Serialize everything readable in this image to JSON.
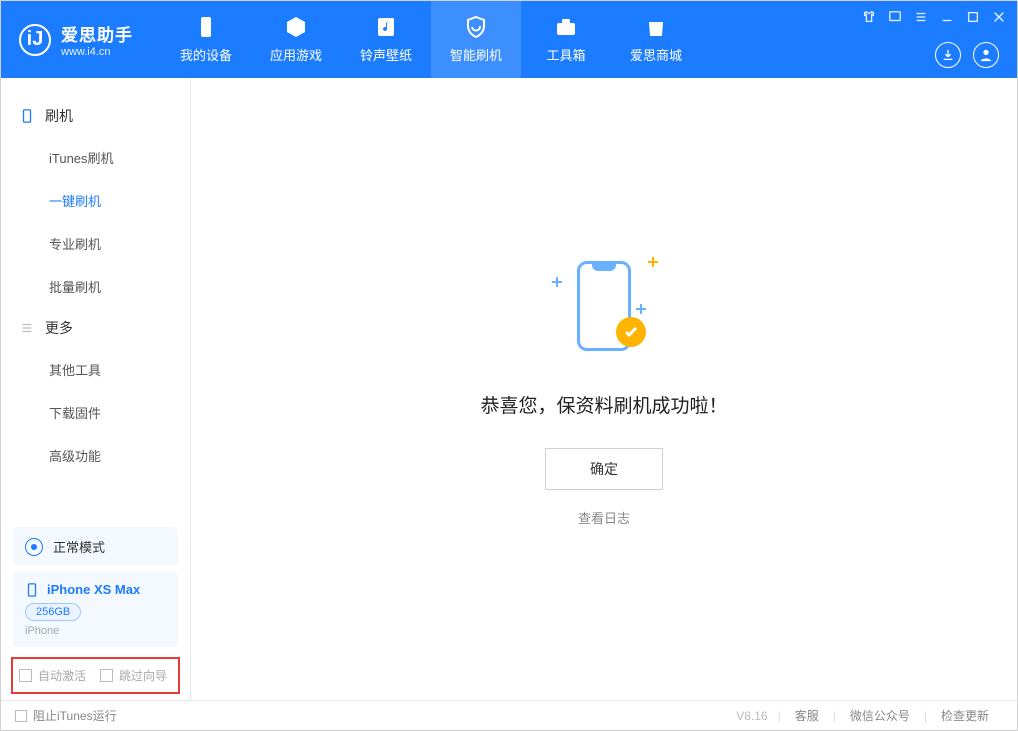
{
  "header": {
    "app_name": "爱思助手",
    "app_site": "www.i4.cn",
    "tabs": [
      {
        "label": "我的设备"
      },
      {
        "label": "应用游戏"
      },
      {
        "label": "铃声壁纸"
      },
      {
        "label": "智能刷机"
      },
      {
        "label": "工具箱"
      },
      {
        "label": "爱思商城"
      }
    ]
  },
  "sidebar": {
    "group1_title": "刷机",
    "group1_items": [
      "iTunes刷机",
      "一键刷机",
      "专业刷机",
      "批量刷机"
    ],
    "group2_title": "更多",
    "group2_items": [
      "其他工具",
      "下载固件",
      "高级功能"
    ],
    "status_label": "正常模式",
    "device_name": "iPhone XS Max",
    "device_storage": "256GB",
    "device_type": "iPhone",
    "checkbox_activate": "自动激活",
    "checkbox_skip": "跳过向导"
  },
  "main": {
    "success_message": "恭喜您，保资料刷机成功啦！",
    "ok_button": "确定",
    "view_log": "查看日志"
  },
  "footer": {
    "block_itunes": "阻止iTunes运行",
    "version": "V8.16",
    "links": [
      "客服",
      "微信公众号",
      "检查更新"
    ]
  }
}
